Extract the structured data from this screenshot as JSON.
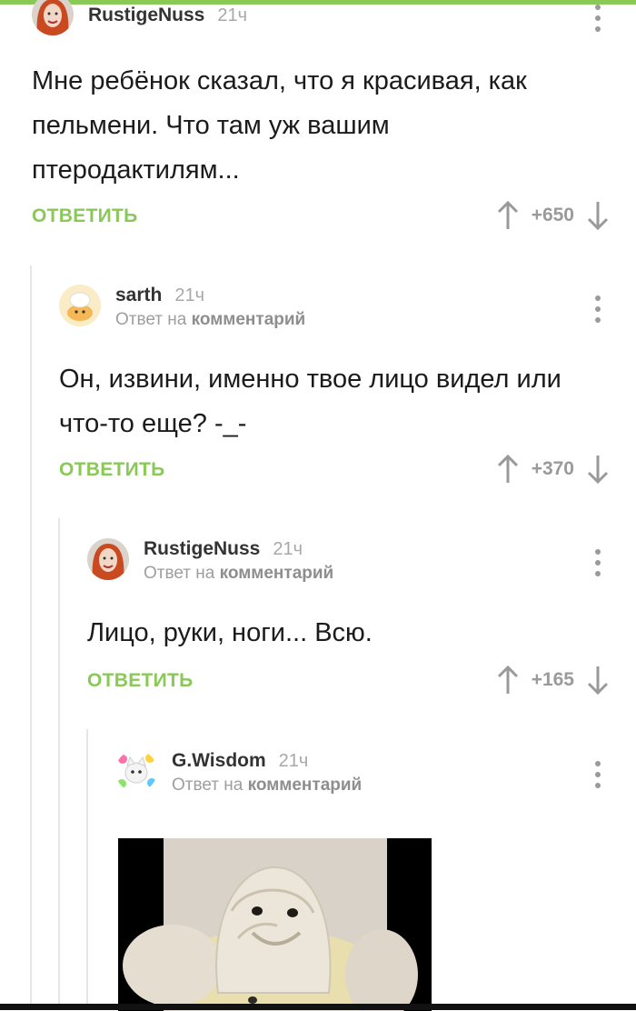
{
  "comments": [
    {
      "author": "RustigeNuss",
      "time": "21ч",
      "text": "Мне ребёнок сказал, что я красивая, как пельмени. Что там уж вашим птеродактилям...",
      "reply_label": "ОТВЕТИТЬ",
      "score": "+650"
    },
    {
      "author": "sarth",
      "time": "21ч",
      "reply_prefix": "Ответ на",
      "reply_link": "комментарий",
      "text": "Он, извини, именно твое лицо видел или что-то еще? -_-",
      "reply_label": "ОТВЕТИТЬ",
      "score": "+370"
    },
    {
      "author": "RustigeNuss",
      "time": "21ч",
      "reply_prefix": "Ответ на",
      "reply_link": "комментарий",
      "text": "Лицо, руки, ноги... Всю.",
      "reply_label": "ОТВЕТИТЬ",
      "score": "+165"
    },
    {
      "author": "G.Wisdom",
      "time": "21ч",
      "reply_prefix": "Ответ на",
      "reply_link": "комментарий"
    }
  ],
  "colors": {
    "accent": "#8ac858",
    "text": "#1b1b1b",
    "muted": "#9e9e9e"
  },
  "icons": [
    "more-vert-icon",
    "arrow-up-icon",
    "arrow-down-icon"
  ]
}
